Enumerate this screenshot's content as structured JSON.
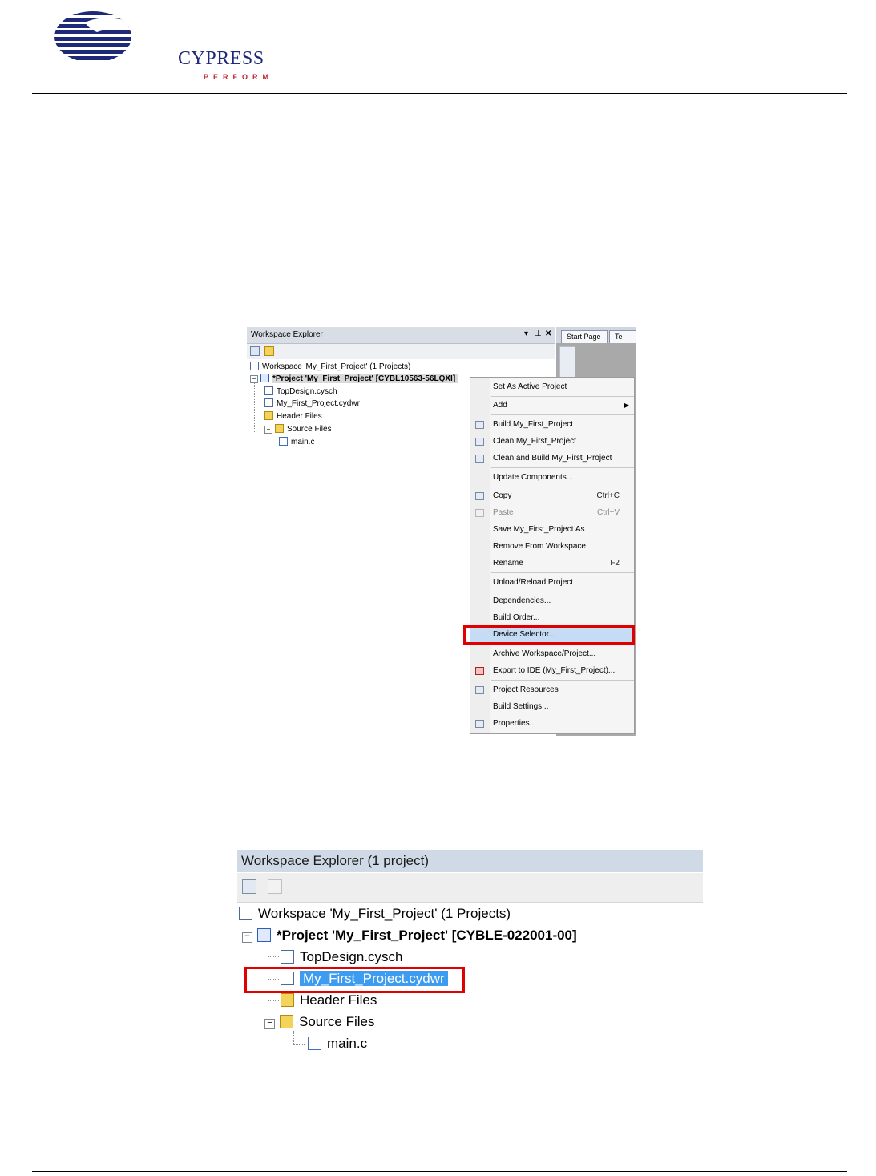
{
  "header": {
    "logo_text": "CYPRESS",
    "logo_subtext": "PERFORM"
  },
  "screenshot1": {
    "panel_title": "Workspace Explorer",
    "panel_controls": [
      "▾",
      "⊥",
      "✕"
    ],
    "tabs": [
      "Start Page",
      "Te"
    ],
    "tree": {
      "workspace": "Workspace 'My_First_Project' (1 Projects)",
      "project": "*Project  'My_First_Project' [CYBL10563-56LQXI]",
      "items": [
        {
          "label": "TopDesign.cysch",
          "icon": "schematic-icon"
        },
        {
          "label": "My_First_Project.cydwr",
          "icon": "design-wide-resources-icon"
        },
        {
          "label": "Header Files",
          "icon": "folder-icon"
        },
        {
          "label": "Source Files",
          "icon": "folder-icon"
        },
        {
          "label": "main.c",
          "icon": "c-file-icon"
        }
      ]
    },
    "context_menu": [
      {
        "label": "Set As Active Project",
        "shortcut": "",
        "icon": "",
        "disabled": false
      },
      {
        "label": "Add",
        "shortcut": "",
        "icon": "",
        "disabled": false,
        "submenu": true
      },
      {
        "label": "Build My_First_Project",
        "shortcut": "",
        "icon": "build-icon",
        "disabled": false
      },
      {
        "label": "Clean My_First_Project",
        "shortcut": "",
        "icon": "clean-icon",
        "disabled": false
      },
      {
        "label": "Clean and Build My_First_Project",
        "shortcut": "",
        "icon": "clean-build-icon",
        "disabled": false
      },
      {
        "label": "Update Components...",
        "shortcut": "",
        "icon": "",
        "disabled": false
      },
      {
        "label": "Copy",
        "shortcut": "Ctrl+C",
        "icon": "copy-icon",
        "disabled": false
      },
      {
        "label": "Paste",
        "shortcut": "Ctrl+V",
        "icon": "paste-icon",
        "disabled": true
      },
      {
        "label": "Save My_First_Project As",
        "shortcut": "",
        "icon": "",
        "disabled": false
      },
      {
        "label": "Remove From Workspace",
        "shortcut": "",
        "icon": "",
        "disabled": false
      },
      {
        "label": "Rename",
        "shortcut": "F2",
        "icon": "",
        "disabled": false
      },
      {
        "label": "Unload/Reload Project",
        "shortcut": "",
        "icon": "",
        "disabled": false
      },
      {
        "label": "Dependencies...",
        "shortcut": "",
        "icon": "",
        "disabled": false
      },
      {
        "label": "Build Order...",
        "shortcut": "",
        "icon": "",
        "disabled": false
      },
      {
        "label": "Device Selector...",
        "shortcut": "",
        "icon": "",
        "disabled": false,
        "highlighted": true
      },
      {
        "label": "Archive Workspace/Project...",
        "shortcut": "",
        "icon": "",
        "disabled": false
      },
      {
        "label": "Export to IDE (My_First_Project)...",
        "shortcut": "",
        "icon": "export-icon",
        "disabled": false
      },
      {
        "label": "Project Resources",
        "shortcut": "",
        "icon": "resources-icon",
        "disabled": false
      },
      {
        "label": "Build Settings...",
        "shortcut": "",
        "icon": "",
        "disabled": false
      },
      {
        "label": "Properties...",
        "shortcut": "",
        "icon": "properties-icon",
        "disabled": false
      }
    ]
  },
  "screenshot2": {
    "panel_title": "Workspace Explorer (1 project)",
    "tree": {
      "workspace": "Workspace 'My_First_Project' (1 Projects)",
      "project": "*Project  'My_First_Project' [CYBLE-022001-00]",
      "items": [
        {
          "label": "TopDesign.cysch",
          "icon": "schematic-icon"
        },
        {
          "label": "My_First_Project.cydwr",
          "icon": "design-wide-resources-icon",
          "selected": true
        },
        {
          "label": "Header Files",
          "icon": "folder-icon"
        },
        {
          "label": "Source Files",
          "icon": "folder-icon"
        },
        {
          "label": "main.c",
          "icon": "c-file-icon"
        }
      ]
    }
  },
  "colors": {
    "highlight_box": "#e00000",
    "selection": "#3d9cf0",
    "logo_blue": "#1e2a78",
    "logo_red": "#c0282f"
  }
}
